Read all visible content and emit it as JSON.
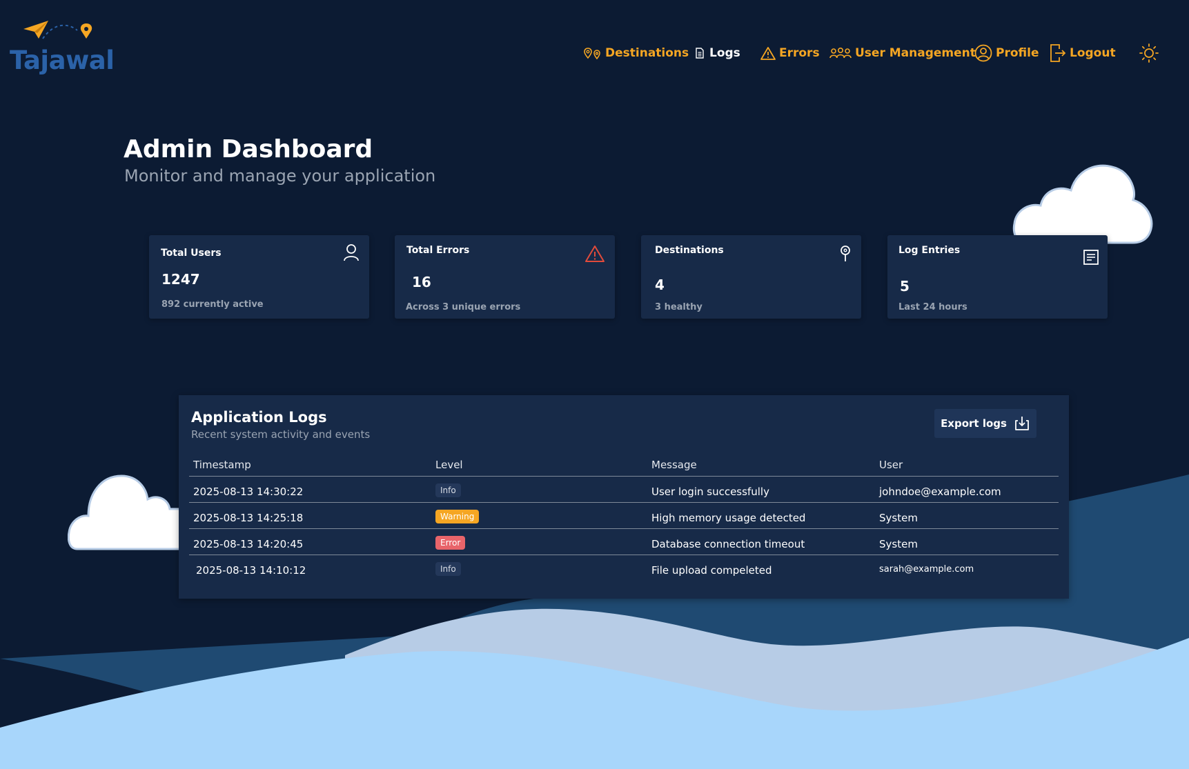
{
  "brand": {
    "name": "Tajawal",
    "logo_color": "#2b62a8",
    "accent": "#f5a623"
  },
  "nav": {
    "destinations": "Destinations",
    "logs": "Logs",
    "errors": "Errors",
    "user_management": "User Management",
    "profile": "Profile",
    "logout": "Logout",
    "theme_toggle_icon": "sun-icon"
  },
  "header": {
    "title": "Admin Dashboard",
    "subtitle": "Monitor and manage your application"
  },
  "stats": [
    {
      "label": "Total Users",
      "value": "1247",
      "sub": "892 currently active",
      "icon": "user-icon"
    },
    {
      "label": "Total Errors",
      "value": "16",
      "sub": "Across 3 unique errors",
      "icon": "warning-icon"
    },
    {
      "label": "Destinations",
      "value": "4",
      "sub": "3 healthy",
      "icon": "location-pin-icon"
    },
    {
      "label": "Log Entries",
      "value": "5",
      "sub": "Last 24 hours",
      "icon": "document-icon"
    }
  ],
  "logs": {
    "title": "Application Logs",
    "subtitle": "Recent system activity and events",
    "export_label": "Export logs",
    "columns": [
      "Timestamp",
      "Level",
      "Message",
      "User"
    ],
    "rows": [
      {
        "timestamp": "2025-08-13 14:30:22",
        "level": "Info",
        "message": "User login successfully",
        "user": "johndoe@example.com"
      },
      {
        "timestamp": "2025-08-13 14:25:18",
        "level": "Warning",
        "message": "High memory usage detected",
        "user": "System"
      },
      {
        "timestamp": "2025-08-13 14:20:45",
        "level": "Error",
        "message": "Database connection timeout",
        "user": "System"
      },
      {
        "timestamp": "2025-08-13 14:10:12",
        "level": "Info",
        "message": "File upload compeleted",
        "user": "sarah@example.com"
      }
    ]
  },
  "colors": {
    "background": "#0c1b33",
    "card": "#172a48",
    "warning": "#f5a623",
    "error": "#e8646a",
    "info": "#24385a"
  }
}
